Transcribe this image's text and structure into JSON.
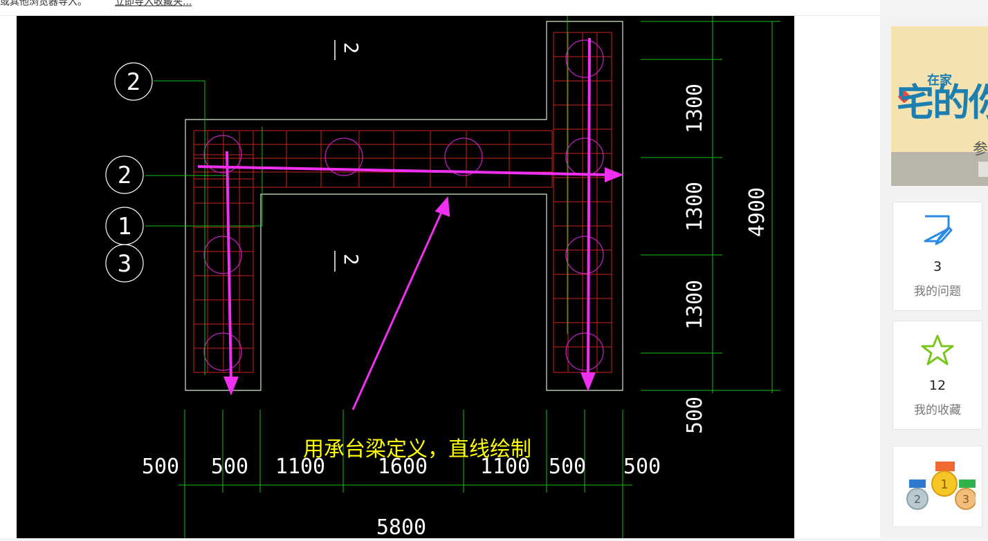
{
  "topbar": {
    "text": "或其他浏览器导入。",
    "link": "立即导入收藏夹..."
  },
  "drawing": {
    "annotation": "用承台梁定义，直线绘制",
    "dims_bottom": [
      "500",
      "500",
      "1100",
      "1600",
      "1100",
      "500",
      "500"
    ],
    "dim_total_bottom": "5800",
    "dims_right": [
      "1300",
      "1300",
      "1300",
      "500"
    ],
    "dim_total_right": "4900",
    "section_marks": [
      "2",
      "2"
    ],
    "callouts": [
      "2",
      "2",
      "1",
      "3"
    ],
    "colors": {
      "outline": "#d8ecd0",
      "rebar": "#d21f1f",
      "pile": "#c020c0",
      "dim": "#16c016",
      "arrow": "#f030f0",
      "text": "#ffff00"
    }
  },
  "sidebar": {
    "questions": {
      "count": "3",
      "label": "我的问题",
      "icon": "edit-note-icon"
    },
    "favorites": {
      "count": "12",
      "label": "我的收藏",
      "icon": "star-icon"
    },
    "medals": {
      "labels": [
        "1",
        "2",
        "3"
      ],
      "icon": "medals-icon"
    },
    "banner": {
      "t1": "在家",
      "t2": "宅的你",
      "t3": "参"
    }
  }
}
